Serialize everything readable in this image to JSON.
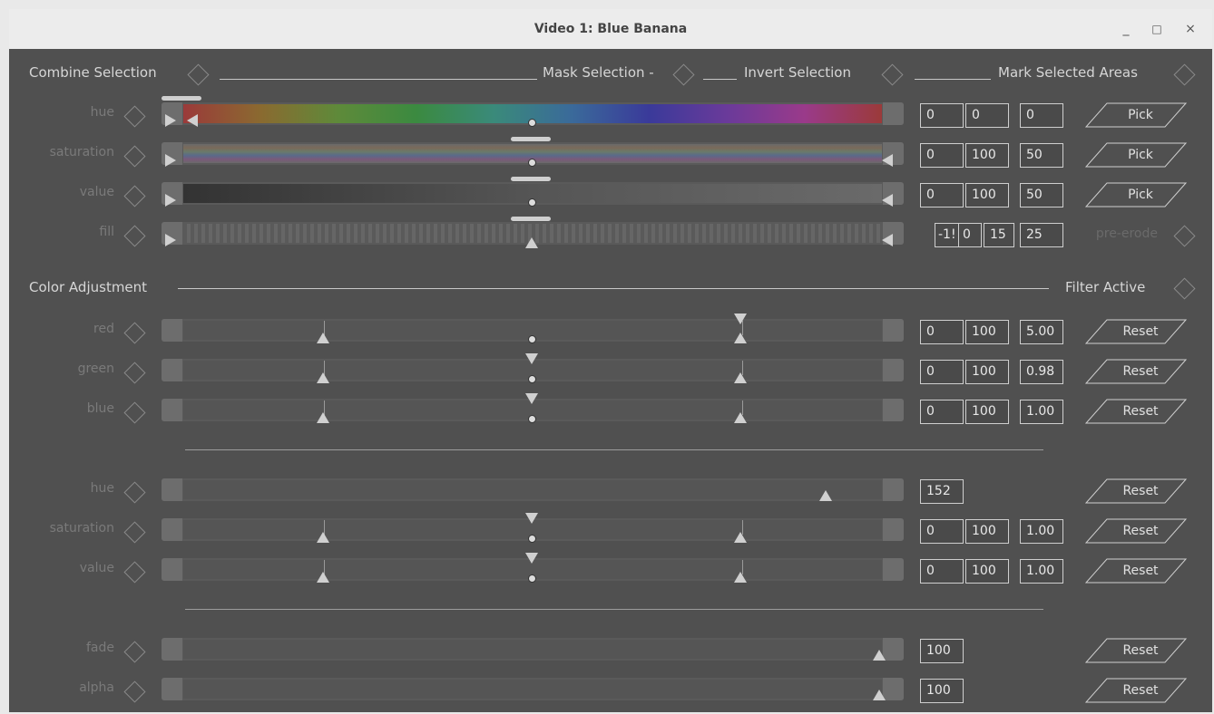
{
  "window": {
    "title": "Video 1: Blue Banana",
    "controls": [
      "_",
      "□",
      "×"
    ]
  },
  "headers": {
    "combine": "Combine Selection",
    "mask": "Mask Selection -",
    "invert": "Invert Selection",
    "mark": "Mark Selected Areas",
    "color_adj": "Color Adjustment",
    "filter_active": "Filter Active"
  },
  "selection_rows": [
    {
      "label": "hue",
      "v1": "0",
      "v2": "0",
      "v3": "0",
      "button": "Pick"
    },
    {
      "label": "saturation",
      "v1": "0",
      "v2": "100",
      "v3": "50",
      "button": "Pick"
    },
    {
      "label": "value",
      "v1": "0",
      "v2": "100",
      "v3": "50",
      "button": "Pick"
    },
    {
      "label": "fill",
      "v1": "-1!",
      "v2": "0",
      "v3": "15",
      "v4": "25",
      "button": "pre-erode"
    }
  ],
  "rgb_rows": [
    {
      "label": "red",
      "v1": "0",
      "v2": "100",
      "v3": "5.00",
      "button": "Reset"
    },
    {
      "label": "green",
      "v1": "0",
      "v2": "100",
      "v3": "0.98",
      "button": "Reset"
    },
    {
      "label": "blue",
      "v1": "0",
      "v2": "100",
      "v3": "1.00",
      "button": "Reset"
    }
  ],
  "hsv_rows": [
    {
      "label": "hue",
      "v1": "152",
      "button": "Reset"
    },
    {
      "label": "saturation",
      "v1": "0",
      "v2": "100",
      "v3": "1.00",
      "button": "Reset"
    },
    {
      "label": "value",
      "v1": "0",
      "v2": "100",
      "v3": "1.00",
      "button": "Reset"
    }
  ],
  "final_rows": [
    {
      "label": "fade",
      "v1": "100",
      "button": "Reset"
    },
    {
      "label": "alpha",
      "v1": "100",
      "button": "Reset"
    }
  ],
  "colors": {
    "bg": "#505050",
    "titlebar": "#ececec",
    "accent": "#e87a1e"
  }
}
